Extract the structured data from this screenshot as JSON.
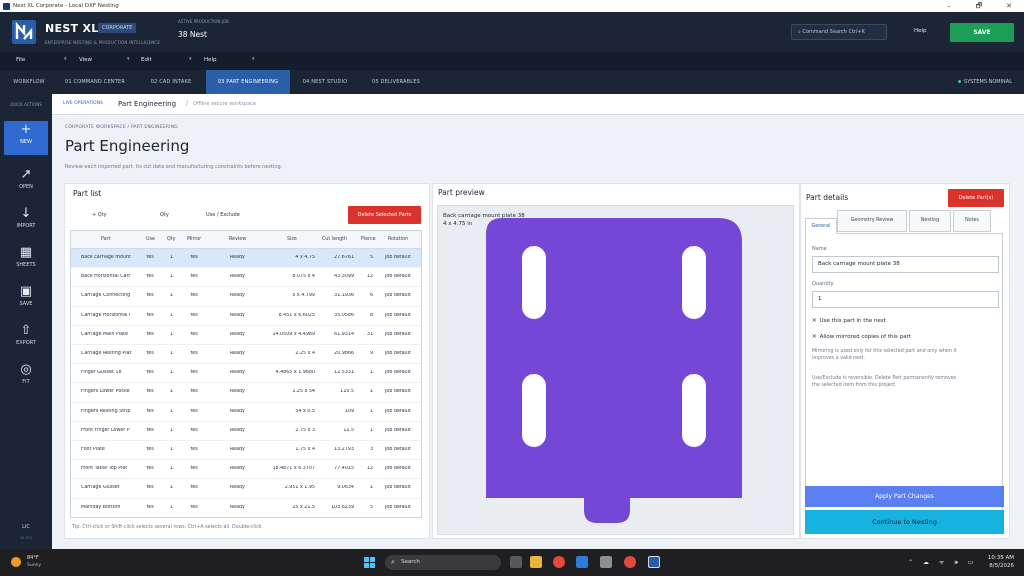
{
  "window": {
    "title": "Nest XL Corporate - Local DXF Nesting",
    "minimize": "–",
    "maximize": "🗗",
    "close": "✕"
  },
  "header": {
    "brand": "NEST XL",
    "badge": "CORPORATE",
    "tagline": "ENTERPRISE NESTING & PRODUCTION INTELLIGENCE",
    "active_label": "ACTIVE PRODUCTION JOB",
    "active_value": "38 Nest",
    "command_search": "⌕ Command Search   Ctrl+K",
    "help": "Help",
    "save": "SAVE"
  },
  "menu": [
    "File",
    "View",
    "Edit",
    "Help"
  ],
  "tabs": [
    "WORKFLOW",
    "01 COMMAND CENTER",
    "02 CAD INTAKE",
    "03 PART ENGINEERING",
    "04 NEST STUDIO",
    "05 DELIVERABLES"
  ],
  "active_tab": "03 PART ENGINEERING",
  "system_status": "SYSTEMS NOMINAL",
  "rail": {
    "quick_label": "QUICK ACTIONS",
    "items": [
      {
        "label": "NEW",
        "icon": "+"
      },
      {
        "label": "OPEN",
        "icon": "↗"
      },
      {
        "label": "IMPORT",
        "icon": "↓"
      },
      {
        "label": "SHEETS",
        "icon": "▦"
      },
      {
        "label": "SAVE",
        "icon": "▣"
      },
      {
        "label": "EXPORT",
        "icon": "⇧"
      },
      {
        "label": "FIT",
        "icon": "◎"
      }
    ],
    "lic": "LIC",
    "lic_sub": "10.371"
  },
  "breadcrumb": {
    "live": "LIVE OPERATIONS",
    "current": "Part Engineering",
    "separator": "/",
    "offline": "Offline secure workspace"
  },
  "page": {
    "workspace_crumb": "CORPORATE WORKSPACE / PART ENGINEERING",
    "title": "Part Engineering",
    "subtitle": "Review each imported part, its cut data and manufacturing constraints before nesting."
  },
  "part_list": {
    "title": "Part list",
    "qty_plus": "+ Qty",
    "qty_minus": "Qty",
    "use_exclude": "Use / Exclude",
    "delete_selected": "Delete Selected Parts",
    "columns": [
      "Part",
      "Use",
      "Qty",
      "Mirror",
      "Review",
      "Size",
      "Cut length",
      "Pierce",
      "Rotation"
    ],
    "rows": [
      [
        "Back carriage mount",
        "Yes",
        "1",
        "Yes",
        "Ready",
        "4 x 4.75",
        "27.6761",
        "5",
        "Job default"
      ],
      [
        "Back Horizontal Carr",
        "Yes",
        "1",
        "Yes",
        "Ready",
        "8.075 x 4",
        "43.3099",
        "12",
        "Job default"
      ],
      [
        "Carriage Connecting",
        "Yes",
        "1",
        "Yes",
        "Ready",
        "5 x 4.799",
        "31.1936",
        "6",
        "Job default"
      ],
      [
        "Carriage Horizontal I",
        "Yes",
        "1",
        "Yes",
        "Ready",
        "8.451 x 6.6025",
        "35.0586",
        "8",
        "Job default"
      ],
      [
        "Carriage Main Plate",
        "Yes",
        "1",
        "Yes",
        "Ready",
        "14.0509 x 4.4989",
        "61.9314",
        "31",
        "Job default"
      ],
      [
        "Carriage Resting Plat",
        "Yes",
        "1",
        "Yes",
        "Ready",
        "2.25 x 4",
        "20.9866",
        "9",
        "Job default"
      ],
      [
        "Finger Gusset 18",
        "Yes",
        "1",
        "Yes",
        "Ready",
        "4.4865 x 1.9680",
        "12.5331",
        "1",
        "Job default"
      ],
      [
        "Fingers Lower Pocke",
        "Yes",
        "1",
        "Yes",
        "Ready",
        "1.25 x 54",
        "110.5",
        "1",
        "Job default"
      ],
      [
        "Fingers Resting Strip",
        "Yes",
        "1",
        "Yes",
        "Ready",
        "54 x 0.5",
        "109",
        "1",
        "Job default"
      ],
      [
        "Front Finger Lower P",
        "Yes",
        "1",
        "Yes",
        "Ready",
        "2.75 x 3",
        "11.5",
        "1",
        "Job default"
      ],
      [
        "Foot Plate",
        "Yes",
        "1",
        "Yes",
        "Ready",
        "1.75 x 4",
        "13.2793",
        "3",
        "Job default"
      ],
      [
        "Front Table Top Plat",
        "Yes",
        "1",
        "Yes",
        "Ready",
        "18.4871 x 6.3707",
        "77.4015",
        "12",
        "Job default"
      ],
      [
        "Carriage Gusset",
        "Yes",
        "1",
        "Yes",
        "Ready",
        "2.951 x 1.95",
        "9.0634",
        "1",
        "Job default"
      ],
      [
        "Mainday Bottom",
        "Yes",
        "1",
        "Yes",
        "Ready",
        "25 x 21.5",
        "103.6239",
        "5",
        "Job default"
      ]
    ],
    "hint": "Tip: Ctrl-click or Shift-click selects several rows; Ctrl+A selects all. Double-click"
  },
  "preview": {
    "title": "Part preview",
    "caption_name": "Back carriage mount plate 38",
    "caption_size": "4 x 4.75 in",
    "fill": "#7447d6"
  },
  "details": {
    "title": "Part details",
    "delete_btn": "Delete Part(s)",
    "tabs": [
      "General",
      "Geometry Review",
      "Nesting",
      "Notes"
    ],
    "name_label": "Name",
    "name_value": "Back carriage mount plate 38",
    "qty_label": "Quantity",
    "qty_value": "1",
    "use_check": "Use this part in the nest",
    "mirror_check": "Allow mirrored copies of this part",
    "check_mark": "✕",
    "mirror_note": "Mirroring is used only for this selected part and only when it improves a valid nest.",
    "exclude_note": "Use/Exclude is reversible. Delete Part permanently removes the selected item from this project.",
    "apply": "Apply Part Changes",
    "continue": "Continue to Nesting"
  },
  "taskbar": {
    "temp": "84°F",
    "condition": "Sunny",
    "search": "Search",
    "time": "10:35 AM",
    "date": "8/5/2026",
    "tray": "⌃ ☁ ᯤ 🕪 ▭"
  }
}
